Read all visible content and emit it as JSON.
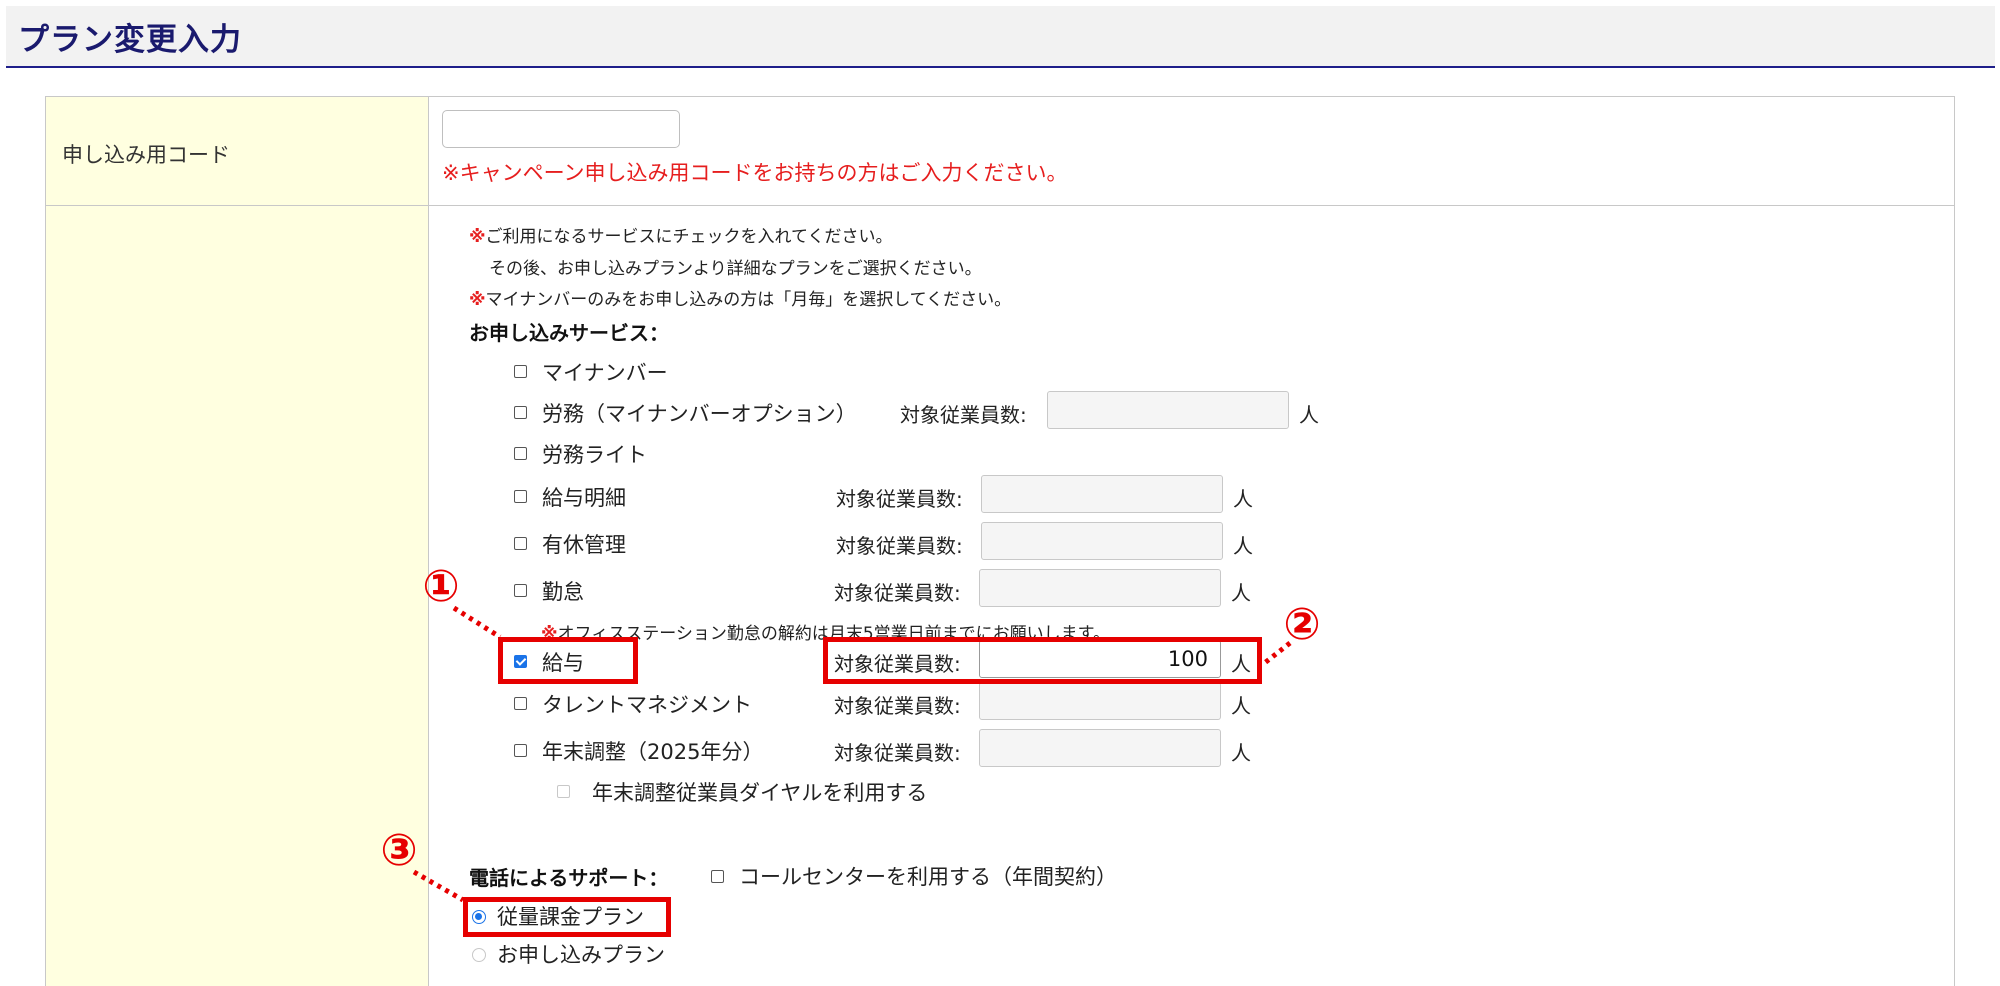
{
  "header": {
    "title": "プラン変更入力"
  },
  "campaign": {
    "label": "申し込み用コード",
    "value": "",
    "note": "※キャンペーン申し込み用コードをお持ちの方はご入力ください。"
  },
  "notes": {
    "mark": "※",
    "line1": "ご利用になるサービスにチェックを入れてください。",
    "line2": "その後、お申し込みプランより詳細なプランをご選択ください。",
    "line3": "マイナンバーのみをお申し込みの方は「月毎」を選択してください。"
  },
  "services": {
    "heading": "お申し込みサービス：",
    "emp_label": "対象従業員数:",
    "unit": "人",
    "items": [
      {
        "label": "マイナンバー",
        "checked": false
      },
      {
        "label": "労務（マイナンバーオプション）",
        "checked": false,
        "employees": ""
      },
      {
        "label": "労務ライト",
        "checked": false
      },
      {
        "label": "給与明細",
        "checked": false,
        "employees": ""
      },
      {
        "label": "有休管理",
        "checked": false,
        "employees": ""
      },
      {
        "label": "勤怠",
        "checked": false,
        "employees": ""
      },
      {
        "label": "給与",
        "checked": true,
        "employees": "100"
      },
      {
        "label": "タレントマネジメント",
        "checked": false,
        "employees": ""
      },
      {
        "label": "年末調整（2025年分）",
        "checked": false,
        "employees": ""
      }
    ],
    "kintai_note_mark": "※",
    "kintai_note": "オフィスステーション勤怠の解約は月末5営業日前までにお願いします。",
    "nenmatsu_dial": "年末調整従業員ダイヤルを利用する"
  },
  "support": {
    "heading": "電話によるサポート：",
    "callcenter": "コールセンターを利用する（年間契約）"
  },
  "plans": [
    {
      "label": "従量課金プラン",
      "selected": true
    },
    {
      "label": "お申し込みプラン",
      "selected": false
    }
  ],
  "annotations": {
    "badge1": "①",
    "badge2": "②",
    "badge3": "③"
  },
  "colors": {
    "accent": "#e60000",
    "header_text": "#1a1a6e",
    "label_bg": "#ffffe0",
    "note_red": "#e61e1e"
  }
}
